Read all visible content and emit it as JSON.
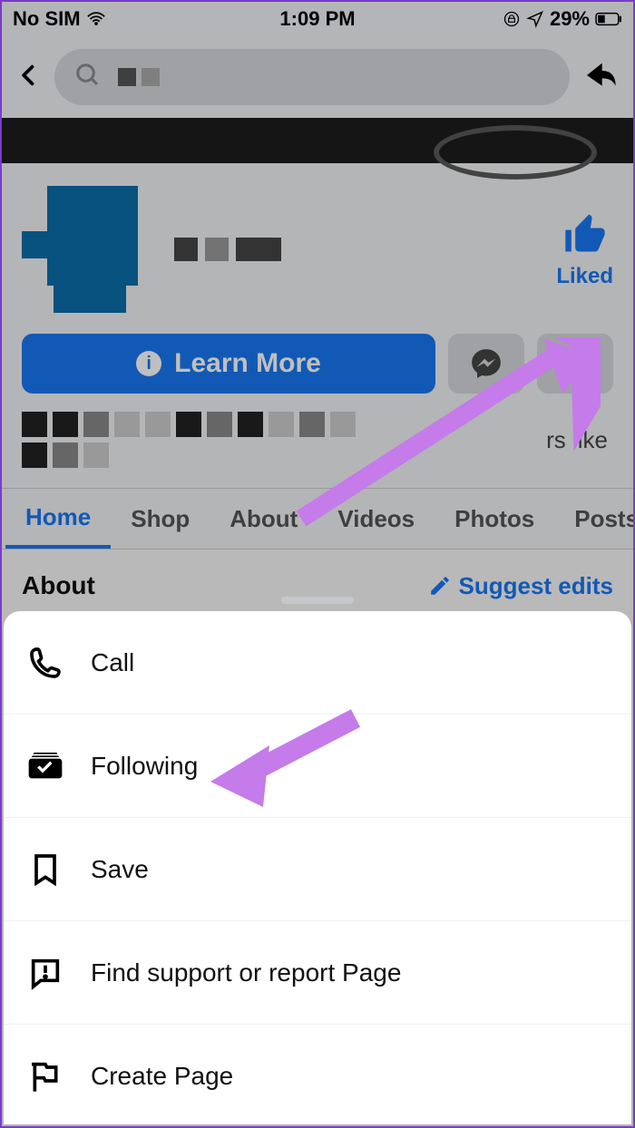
{
  "status": {
    "carrier": "No SIM",
    "time": "1:09 PM",
    "battery": "29%"
  },
  "liked_label": "Liked",
  "learn_more": "Learn More",
  "likes_suffix": "rs like",
  "tabs": [
    "Home",
    "Shop",
    "About",
    "Videos",
    "Photos",
    "Posts"
  ],
  "about_label": "About",
  "suggest_label": "Suggest edits",
  "sheet": {
    "call": "Call",
    "following": "Following",
    "save": "Save",
    "report": "Find support or report Page",
    "create": "Create Page"
  }
}
